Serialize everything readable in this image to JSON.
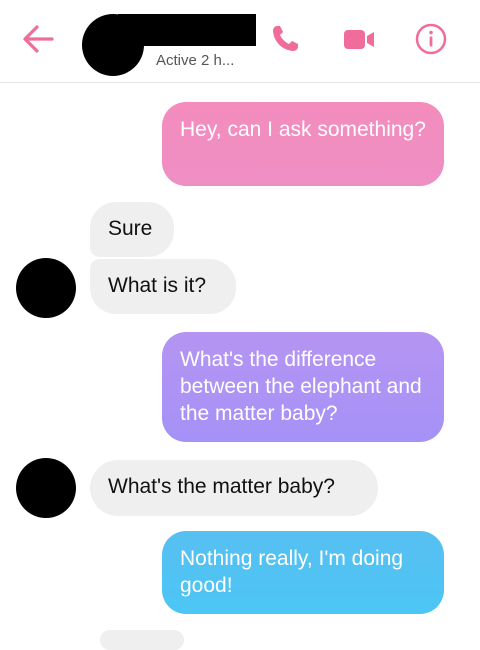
{
  "header": {
    "status": "Active 2 h...",
    "accent_color": "#f06c9b",
    "icons": [
      "back-arrow-icon",
      "phone-icon",
      "video-camera-icon",
      "info-icon"
    ]
  },
  "messages": [
    {
      "side": "sent",
      "text": "Hey, can I ask something?"
    },
    {
      "side": "received",
      "text": "Sure"
    },
    {
      "side": "received",
      "text": "What is it?"
    },
    {
      "side": "sent",
      "text": "What's the difference between the elephant and the matter baby?"
    },
    {
      "side": "received",
      "text": "What's the matter baby?"
    },
    {
      "side": "sent",
      "text": "Nothing really, I'm doing good!"
    }
  ],
  "colors": {
    "sent_pink": "#f08bbf",
    "sent_purple": "#ad93f5",
    "sent_blue": "#52c2f3",
    "received_bg": "#efefef"
  }
}
